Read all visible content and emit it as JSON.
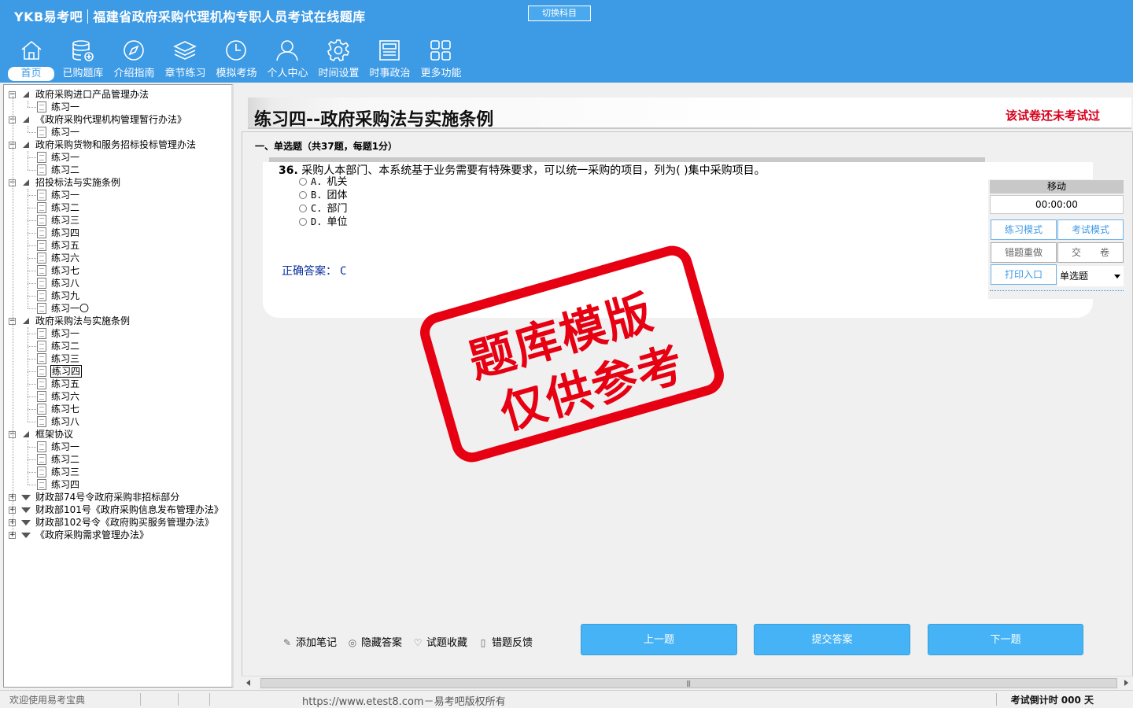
{
  "header": {
    "brand": "YKB易考吧",
    "title": "福建省政府采购代理机构专职人员考试在线题库",
    "switch_subject": "切换科目",
    "nav": [
      {
        "label": "首页",
        "icon": "home-icon",
        "active": true
      },
      {
        "label": "已购题库",
        "icon": "database-icon"
      },
      {
        "label": "介绍指南",
        "icon": "compass-icon"
      },
      {
        "label": "章节练习",
        "icon": "layers-icon"
      },
      {
        "label": "模拟考场",
        "icon": "clock-icon"
      },
      {
        "label": "个人中心",
        "icon": "user-icon"
      },
      {
        "label": "时间设置",
        "icon": "gear-icon"
      },
      {
        "label": "时事政治",
        "icon": "news-icon"
      },
      {
        "label": "更多功能",
        "icon": "grid-icon"
      }
    ]
  },
  "tree": [
    {
      "label": "政府采购进口产品管理办法",
      "expanded": true,
      "children": [
        "练习一"
      ]
    },
    {
      "label": "《政府采购代理机构管理暂行办法》",
      "expanded": true,
      "children": [
        "练习一"
      ]
    },
    {
      "label": "政府采购货物和服务招标投标管理办法",
      "expanded": true,
      "children": [
        "练习一",
        "练习二"
      ]
    },
    {
      "label": "招投标法与实施条例",
      "expanded": true,
      "children": [
        "练习一",
        "练习二",
        "练习三",
        "练习四",
        "练习五",
        "练习六",
        "练习七",
        "练习八",
        "练习九",
        "练习一〇"
      ]
    },
    {
      "label": "政府采购法与实施条例",
      "expanded": true,
      "children": [
        "练习一",
        "练习二",
        "练习三",
        "练习四",
        "练习五",
        "练习六",
        "练习七",
        "练习八"
      ],
      "selected_child": 3
    },
    {
      "label": "框架协议",
      "expanded": true,
      "children": [
        "练习一",
        "练习二",
        "练习三",
        "练习四"
      ]
    },
    {
      "label": "财政部74号令政府采购非招标部分",
      "expanded": false,
      "children": []
    },
    {
      "label": "财政部101号《政府采购信息发布管理办法》",
      "expanded": false,
      "children": []
    },
    {
      "label": "财政部102号令《政府购买服务管理办法》",
      "expanded": false,
      "children": []
    },
    {
      "label": "《政府采购需求管理办法》",
      "expanded": false,
      "children": []
    }
  ],
  "exam": {
    "title": "练习四--政府采购法与实施条例",
    "status": "该试卷还未考试过",
    "section": "一、单选题（共37题，每题1分）",
    "question_number": "36.",
    "question_text": "采购人本部门、本系统基于业务需要有特殊要求，可以统一采购的项目，列为(  )集中采购项目。",
    "options": [
      {
        "key": "A.",
        "text": "机关"
      },
      {
        "key": "B.",
        "text": "团体"
      },
      {
        "key": "C.",
        "text": "部门"
      },
      {
        "key": "D.",
        "text": "单位"
      }
    ],
    "answer_label": "正确答案：",
    "answer_value": "C"
  },
  "control": {
    "move": "移动",
    "timer": "00:00:00",
    "practice_mode": "练习模式",
    "exam_mode": "考试模式",
    "redo_wrong": "错题重做",
    "submit_paper": "交　　卷",
    "print": "打印入口",
    "type_select": "单选题"
  },
  "stamp": {
    "line1": "题库模版",
    "line2": "仅供参考"
  },
  "toolbar": {
    "add_note": "添加笔记",
    "hide_answer": "隐藏答案",
    "favorite": "试题收藏",
    "feedback": "错题反馈",
    "prev": "上一题",
    "submit": "提交答案",
    "next": "下一题"
  },
  "status": {
    "welcome": "欢迎使用易考宝典",
    "copyright": "https://www.etest8.com－易考吧版权所有",
    "countdown": "考试倒计时 000 天"
  }
}
